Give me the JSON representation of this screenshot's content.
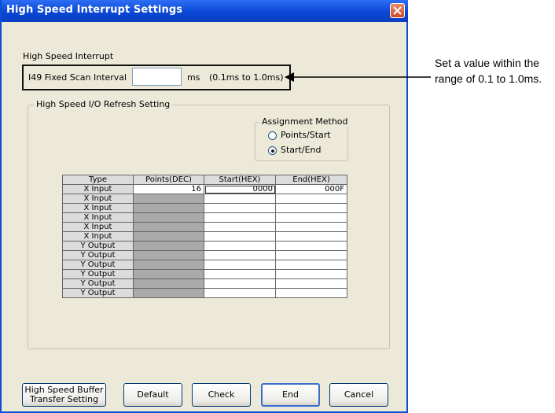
{
  "window": {
    "title": "High Speed Interrupt Settings"
  },
  "high_speed_interrupt": {
    "group_label": "High Speed Interrupt",
    "field_label": "I49 Fixed Scan Interval",
    "value": "",
    "unit": "ms",
    "range_hint": "(0.1ms to 1.0ms)"
  },
  "io_refresh": {
    "group_label": "High Speed I/O Refresh Setting",
    "assignment": {
      "label": "Assignment Method",
      "options": [
        "Points/Start",
        "Start/End"
      ],
      "selected": "Start/End"
    },
    "columns": [
      "Type",
      "Points(DEC)",
      "Start(HEX)",
      "End(HEX)"
    ],
    "rows": [
      {
        "type": "X Input",
        "points": "16",
        "start": "0000",
        "end": "000F"
      },
      {
        "type": "X Input",
        "points": "",
        "start": "",
        "end": ""
      },
      {
        "type": "X Input",
        "points": "",
        "start": "",
        "end": ""
      },
      {
        "type": "X Input",
        "points": "",
        "start": "",
        "end": ""
      },
      {
        "type": "X Input",
        "points": "",
        "start": "",
        "end": ""
      },
      {
        "type": "X Input",
        "points": "",
        "start": "",
        "end": ""
      },
      {
        "type": "Y Output",
        "points": "",
        "start": "",
        "end": ""
      },
      {
        "type": "Y Output",
        "points": "",
        "start": "",
        "end": ""
      },
      {
        "type": "Y Output",
        "points": "",
        "start": "",
        "end": ""
      },
      {
        "type": "Y Output",
        "points": "",
        "start": "",
        "end": ""
      },
      {
        "type": "Y Output",
        "points": "",
        "start": "",
        "end": ""
      },
      {
        "type": "Y Output",
        "points": "",
        "start": "",
        "end": ""
      }
    ]
  },
  "buttons": {
    "buffer_line1": "High Speed Buffer",
    "buffer_line2": "Transfer Setting",
    "default": "Default",
    "check": "Check",
    "end": "End",
    "cancel": "Cancel"
  },
  "annotation": {
    "text": "Set a value within the range of 0.1 to 1.0ms."
  }
}
